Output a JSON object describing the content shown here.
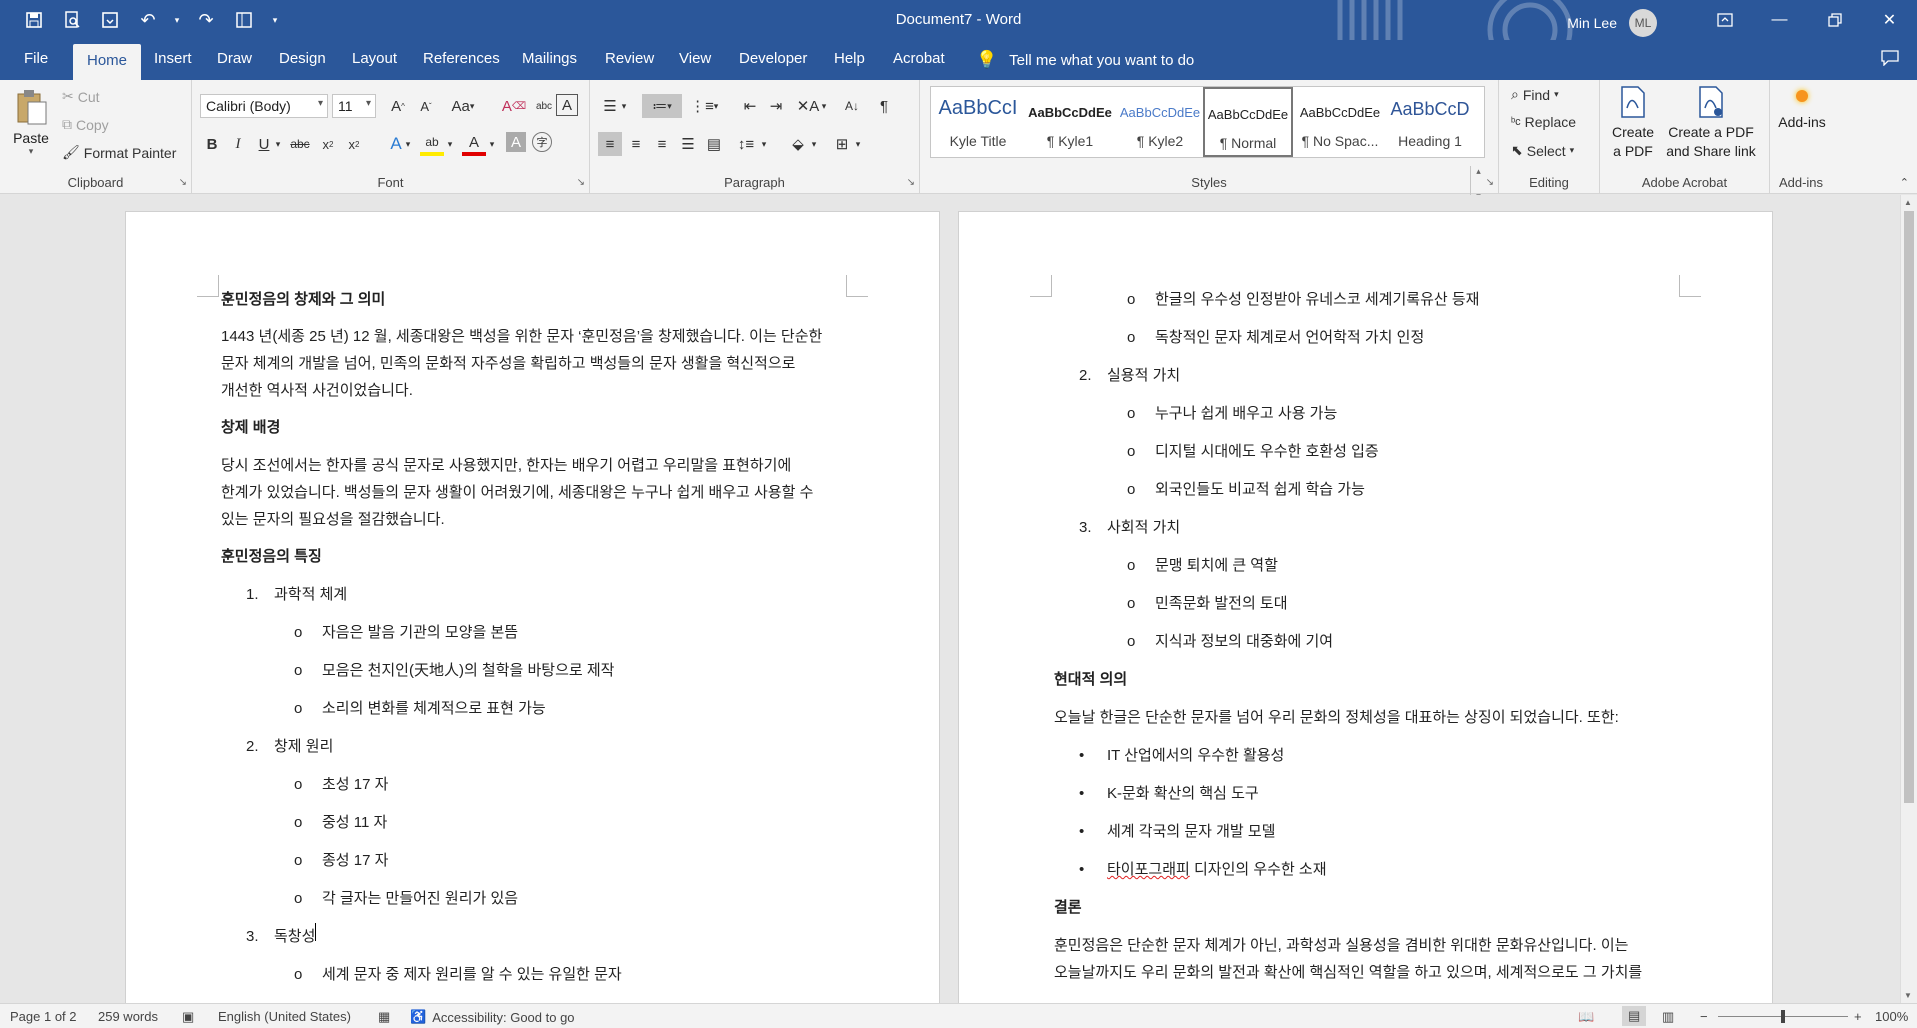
{
  "titlebar": {
    "doc_title": "Document7  -  Word",
    "user_name": "Min Lee",
    "user_initials": "ML"
  },
  "tabs": [
    "File",
    "Home",
    "Insert",
    "Draw",
    "Design",
    "Layout",
    "References",
    "Mailings",
    "Review",
    "View",
    "Developer",
    "Help",
    "Acrobat"
  ],
  "tell_me": "Tell me what you want to do",
  "ribbon": {
    "clipboard": {
      "paste": "Paste",
      "cut": "Cut",
      "copy": "Copy",
      "format_painter": "Format Painter",
      "label": "Clipboard"
    },
    "font": {
      "name": "Calibri (Body)",
      "size": "11",
      "label": "Font",
      "change_case": "Aa"
    },
    "paragraph": {
      "label": "Paragraph"
    },
    "styles": {
      "label": "Styles",
      "items": [
        {
          "preview": "AaBbCcI",
          "name": "Kyle Title"
        },
        {
          "preview": "AaBbCcDdEe",
          "name": "¶ Kyle1"
        },
        {
          "preview": "AaBbCcDdEe",
          "name": "¶ Kyle2"
        },
        {
          "preview": "AaBbCcDdEe",
          "name": "¶ Normal"
        },
        {
          "preview": "AaBbCcDdEe",
          "name": "¶ No Spac..."
        },
        {
          "preview": "AaBbCcD",
          "name": "Heading 1"
        }
      ]
    },
    "editing": {
      "find": "Find",
      "replace": "Replace",
      "select": "Select",
      "label": "Editing"
    },
    "acrobat": {
      "create_pdf_1": "Create",
      "create_pdf_2": "a PDF",
      "share_1": "Create a PDF",
      "share_2": "and Share link",
      "label": "Adobe Acrobat"
    },
    "addins": {
      "button": "Add-ins",
      "label": "Add-ins"
    }
  },
  "page1": {
    "title": "훈민정음의 창제와 그 의미",
    "intro": [
      "1443 년(세종 25 년) 12 월, 세종대왕은 백성을 위한 문자 ‘훈민정음’을 창제했습니다. 이는 단순한",
      "문자 체계의 개발을 넘어, 민족의 문화적 자주성을 확립하고 백성들의 문자 생활을 혁신적으로",
      "개선한 역사적 사건이었습니다."
    ],
    "h_background": "창제 배경",
    "background": [
      "당시 조선에서는 한자를 공식 문자로 사용했지만, 한자는 배우기 어렵고 우리말을 표현하기에",
      "한계가 있었습니다. 백성들의 문자 생활이 어려웠기에, 세종대왕은 누구나 쉽게 배우고 사용할 수",
      "있는 문자의 필요성을 절감했습니다."
    ],
    "h_features": "훈민정음의 특징",
    "list": [
      {
        "marker": "1.",
        "text": "과학적 체계"
      },
      {
        "marker": "o",
        "text": "자음은 발음 기관의 모양을 본뜸"
      },
      {
        "marker": "o",
        "text": "모음은 천지인(天地人)의 철학을 바탕으로 제작"
      },
      {
        "marker": "o",
        "text": "소리의 변화를 체계적으로 표현 가능"
      },
      {
        "marker": "2.",
        "text": "창제 원리"
      },
      {
        "marker": "o",
        "text": "초성 17 자"
      },
      {
        "marker": "o",
        "text": "중성 11 자"
      },
      {
        "marker": "o",
        "text": "종성 17 자"
      },
      {
        "marker": "o",
        "text": "각 글자는 만들어진 원리가 있음"
      },
      {
        "marker": "3.",
        "text": "독창성"
      },
      {
        "marker": "o",
        "text": "세계 문자 중 제자 원리를 알 수 있는 유일한 문자"
      }
    ]
  },
  "page2": {
    "list": [
      {
        "marker": "o",
        "text": "한글의 우수성 인정받아 유네스코 세계기록유산 등재"
      },
      {
        "marker": "o",
        "text": "독창적인 문자 체계로서 언어학적 가치 인정"
      },
      {
        "marker": "2.",
        "text": "실용적 가치"
      },
      {
        "marker": "o",
        "text": "누구나 쉽게 배우고 사용 가능"
      },
      {
        "marker": "o",
        "text": "디지털 시대에도 우수한 호환성 입증"
      },
      {
        "marker": "o",
        "text": "외국인들도 비교적 쉽게 학습 가능"
      },
      {
        "marker": "3.",
        "text": "사회적 가치"
      },
      {
        "marker": "o",
        "text": "문맹 퇴치에 큰 역할"
      },
      {
        "marker": "o",
        "text": "민족문화 발전의 토대"
      },
      {
        "marker": "o",
        "text": "지식과 정보의 대중화에 기여"
      }
    ],
    "h_modern": "현대적 의의",
    "modern": "오늘날 한글은 단순한 문자를 넘어 우리 문화의 정체성을 대표하는 상징이 되었습니다. 또한:",
    "bullets": [
      "IT 산업에서의 우수한 활용성",
      "K-문화 확산의 핵심 도구",
      "세계 각국의 문자 개발 모델",
      "디자인의 우수한 소재"
    ],
    "bullet4_misspelled": "타이포그래피",
    "h_conclusion": "결론",
    "conclusion": [
      "훈민정음은 단순한 문자 체계가 아닌, 과학성과 실용성을 겸비한 위대한 문화유산입니다. 이는",
      "오늘날까지도 우리 문화의 발전과 확산에 핵심적인 역할을 하고 있으며, 세계적으로도 그 가치를"
    ]
  },
  "status": {
    "page": "Page 1 of 2",
    "words": "259 words",
    "language": "English (United States)",
    "accessibility": "Accessibility: Good to go",
    "zoom": "100%"
  }
}
